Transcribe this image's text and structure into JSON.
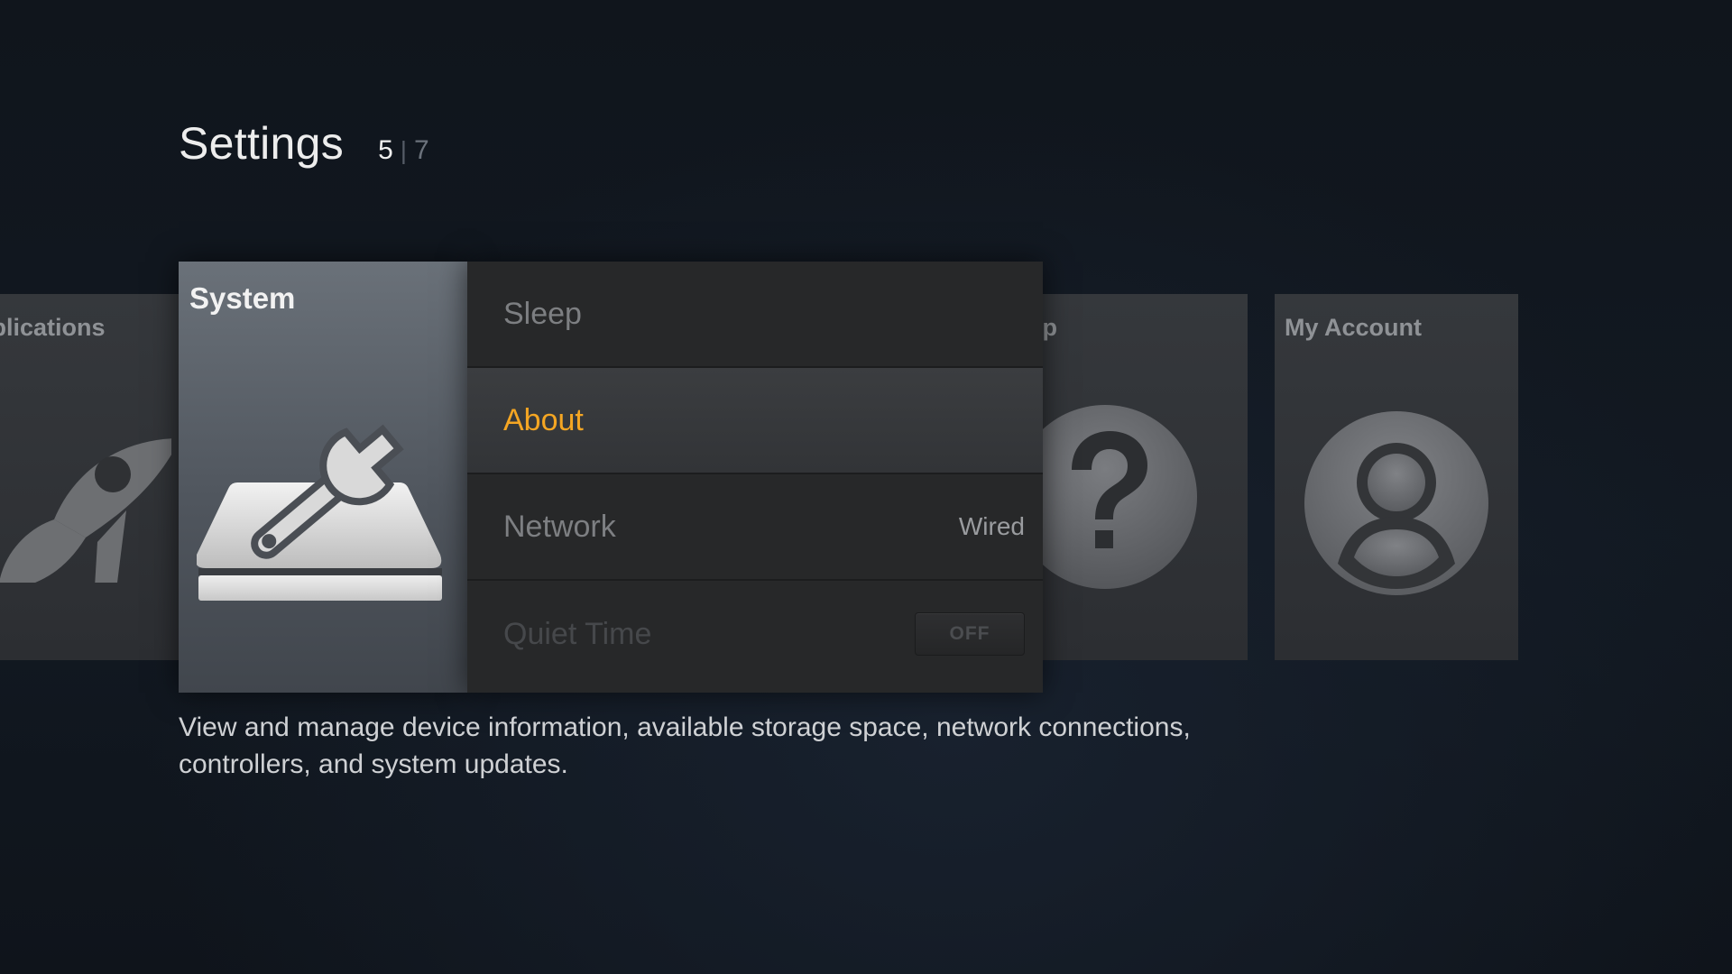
{
  "header": {
    "title": "Settings",
    "page_current": "5",
    "page_separator": "|",
    "page_total": "7"
  },
  "tiles": {
    "applications": {
      "label": "pplications",
      "icon": "rocket-icon"
    },
    "help": {
      "label": "lp",
      "icon": "question-mark-icon"
    },
    "my_account": {
      "label": "My Account",
      "icon": "user-icon"
    }
  },
  "system_card": {
    "title": "System",
    "icon": "drive-wrench-icon"
  },
  "menu": {
    "items": [
      {
        "label": "Sleep",
        "state": "normal"
      },
      {
        "label": "About",
        "state": "selected"
      },
      {
        "label": "Network",
        "value": "Wired",
        "state": "normal"
      },
      {
        "label": "Quiet Time",
        "toggle": "OFF",
        "state": "disabled"
      }
    ]
  },
  "description": "View and manage device information, available storage space, network connections, controllers, and system updates.",
  "colors": {
    "accent": "#f5a623",
    "background": "#121922",
    "menu_bg": "#272829",
    "card_bg": "#5a6068"
  }
}
